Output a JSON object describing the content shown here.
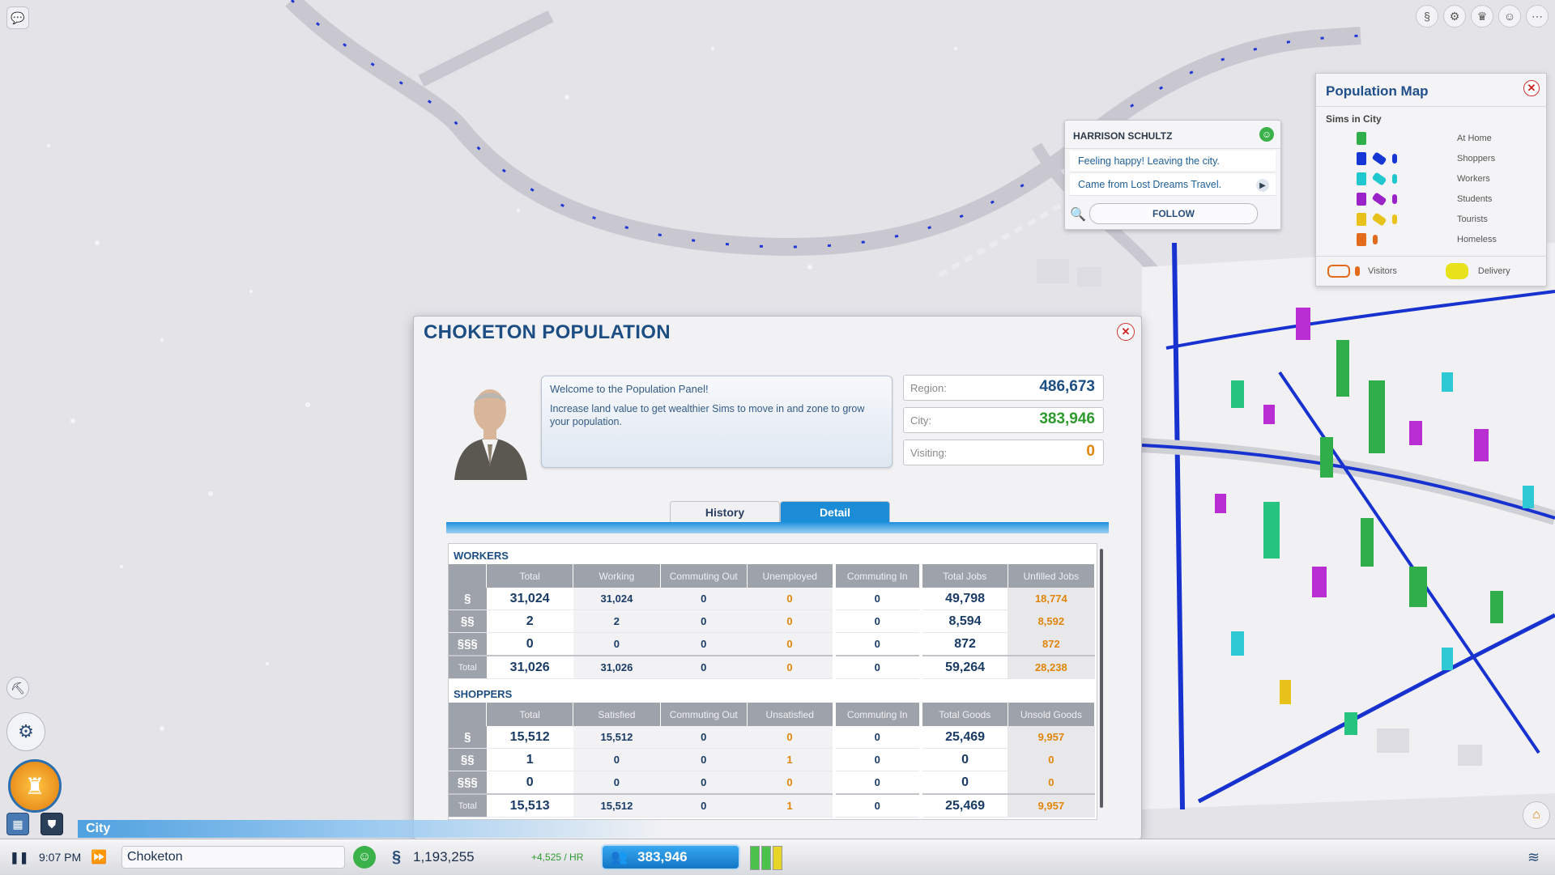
{
  "map_overlay": {
    "title": "Population Map",
    "subtitle": "Sims in City",
    "legend": [
      {
        "label": "At Home",
        "color": "#2fae4a"
      },
      {
        "label": "Shoppers",
        "color": "#1436d4"
      },
      {
        "label": "Workers",
        "color": "#21c7cf"
      },
      {
        "label": "Students",
        "color": "#9b22c9"
      },
      {
        "label": "Tourists",
        "color": "#e8c21a"
      },
      {
        "label": "Homeless",
        "color": "#e26a1c"
      }
    ],
    "visitors_label": "Visitors",
    "delivery_label": "Delivery"
  },
  "sim_card": {
    "name": "HARRISON SCHULTZ",
    "status": "Feeling happy! Leaving the city.",
    "origin": "Came from Lost Dreams Travel.",
    "follow_label": "FOLLOW"
  },
  "panel": {
    "title": "CHOKETON POPULATION",
    "welcome": "Welcome to the Population Panel!",
    "tip": "Increase land value to get wealthier Sims to move in and zone to grow your population.",
    "stats": {
      "region_label": "Region:",
      "region_value": "486,673",
      "city_label": "City:",
      "city_value": "383,946",
      "visiting_label": "Visiting:",
      "visiting_value": "0"
    },
    "tabs": {
      "history": "History",
      "detail": "Detail"
    },
    "workers": {
      "heading": "WORKERS",
      "columns": [
        "Total",
        "Working",
        "Commuting Out",
        "Unemployed",
        "Commuting In",
        "Total Jobs",
        "Unfilled Jobs"
      ],
      "rows": [
        {
          "icon": "§",
          "values": [
            "31,024",
            "31,024",
            "0",
            "0",
            "0",
            "49,798",
            "18,774"
          ]
        },
        {
          "icon": "§§",
          "values": [
            "2",
            "2",
            "0",
            "0",
            "0",
            "8,594",
            "8,592"
          ]
        },
        {
          "icon": "§§§",
          "values": [
            "0",
            "0",
            "0",
            "0",
            "0",
            "872",
            "872"
          ]
        }
      ],
      "total_label": "Total",
      "totals": [
        "31,026",
        "31,026",
        "0",
        "0",
        "0",
        "59,264",
        "28,238"
      ]
    },
    "shoppers": {
      "heading": "SHOPPERS",
      "columns": [
        "Total",
        "Satisfied",
        "Commuting Out",
        "Unsatisfied",
        "Commuting In",
        "Total Goods",
        "Unsold Goods"
      ],
      "rows": [
        {
          "icon": "§",
          "values": [
            "15,512",
            "15,512",
            "0",
            "0",
            "0",
            "25,469",
            "9,957"
          ]
        },
        {
          "icon": "§§",
          "values": [
            "1",
            "0",
            "0",
            "1",
            "0",
            "0",
            "0"
          ]
        },
        {
          "icon": "§§§",
          "values": [
            "0",
            "0",
            "0",
            "0",
            "0",
            "0",
            "0"
          ]
        }
      ],
      "total_label": "Total",
      "totals": [
        "15,513",
        "15,512",
        "0",
        "1",
        "0",
        "25,469",
        "9,957"
      ]
    }
  },
  "bottom_bar": {
    "city_tab": "City",
    "time": "9:07 PM",
    "city_name": "Choketon",
    "funds": "1,193,255",
    "income": "+4,525 / HR",
    "population": "383,946"
  },
  "colors": {
    "accent_blue": "#1c8cd6",
    "title_blue": "#1d4e83",
    "stat_green": "#2e9a2e",
    "stat_orange": "#e0850c",
    "region_blue": "#1d4e83"
  }
}
